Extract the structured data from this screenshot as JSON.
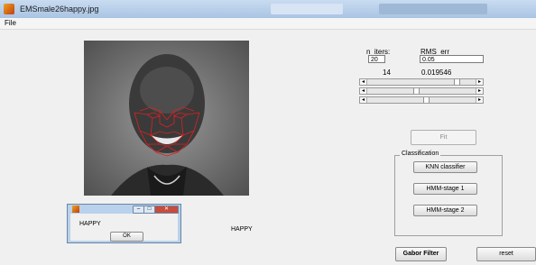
{
  "window": {
    "title": "EMSmale26happy.jpg"
  },
  "menu": {
    "file": "File"
  },
  "params": {
    "n_iters_label": "n_iters:",
    "rms_label": "RMS_err",
    "n_iters_value": "20",
    "rms_value": "0.05",
    "iter_count": "14",
    "rms_current": "0.019546"
  },
  "sliders": [
    {
      "name": "slider-1",
      "position": 0.85
    },
    {
      "name": "slider-2",
      "position": 0.45
    },
    {
      "name": "slider-3",
      "position": 0.55
    }
  ],
  "buttons": {
    "fit": "Fit",
    "knn": "KNN classifier",
    "hmm1": "HMM-stage 1",
    "hmm2": "HMM-stage 2",
    "gabor": "Gabor Filter",
    "reset": "reset"
  },
  "classification": {
    "legend": "Classification"
  },
  "result": {
    "text": "HAPPY"
  },
  "dialog": {
    "message": "HAPPY",
    "ok": "OK"
  },
  "colors": {
    "landmarks": "#e02020",
    "titlebar": "#b8cfe8"
  },
  "icons": {
    "app": "matlab-icon",
    "close": "close-icon"
  }
}
